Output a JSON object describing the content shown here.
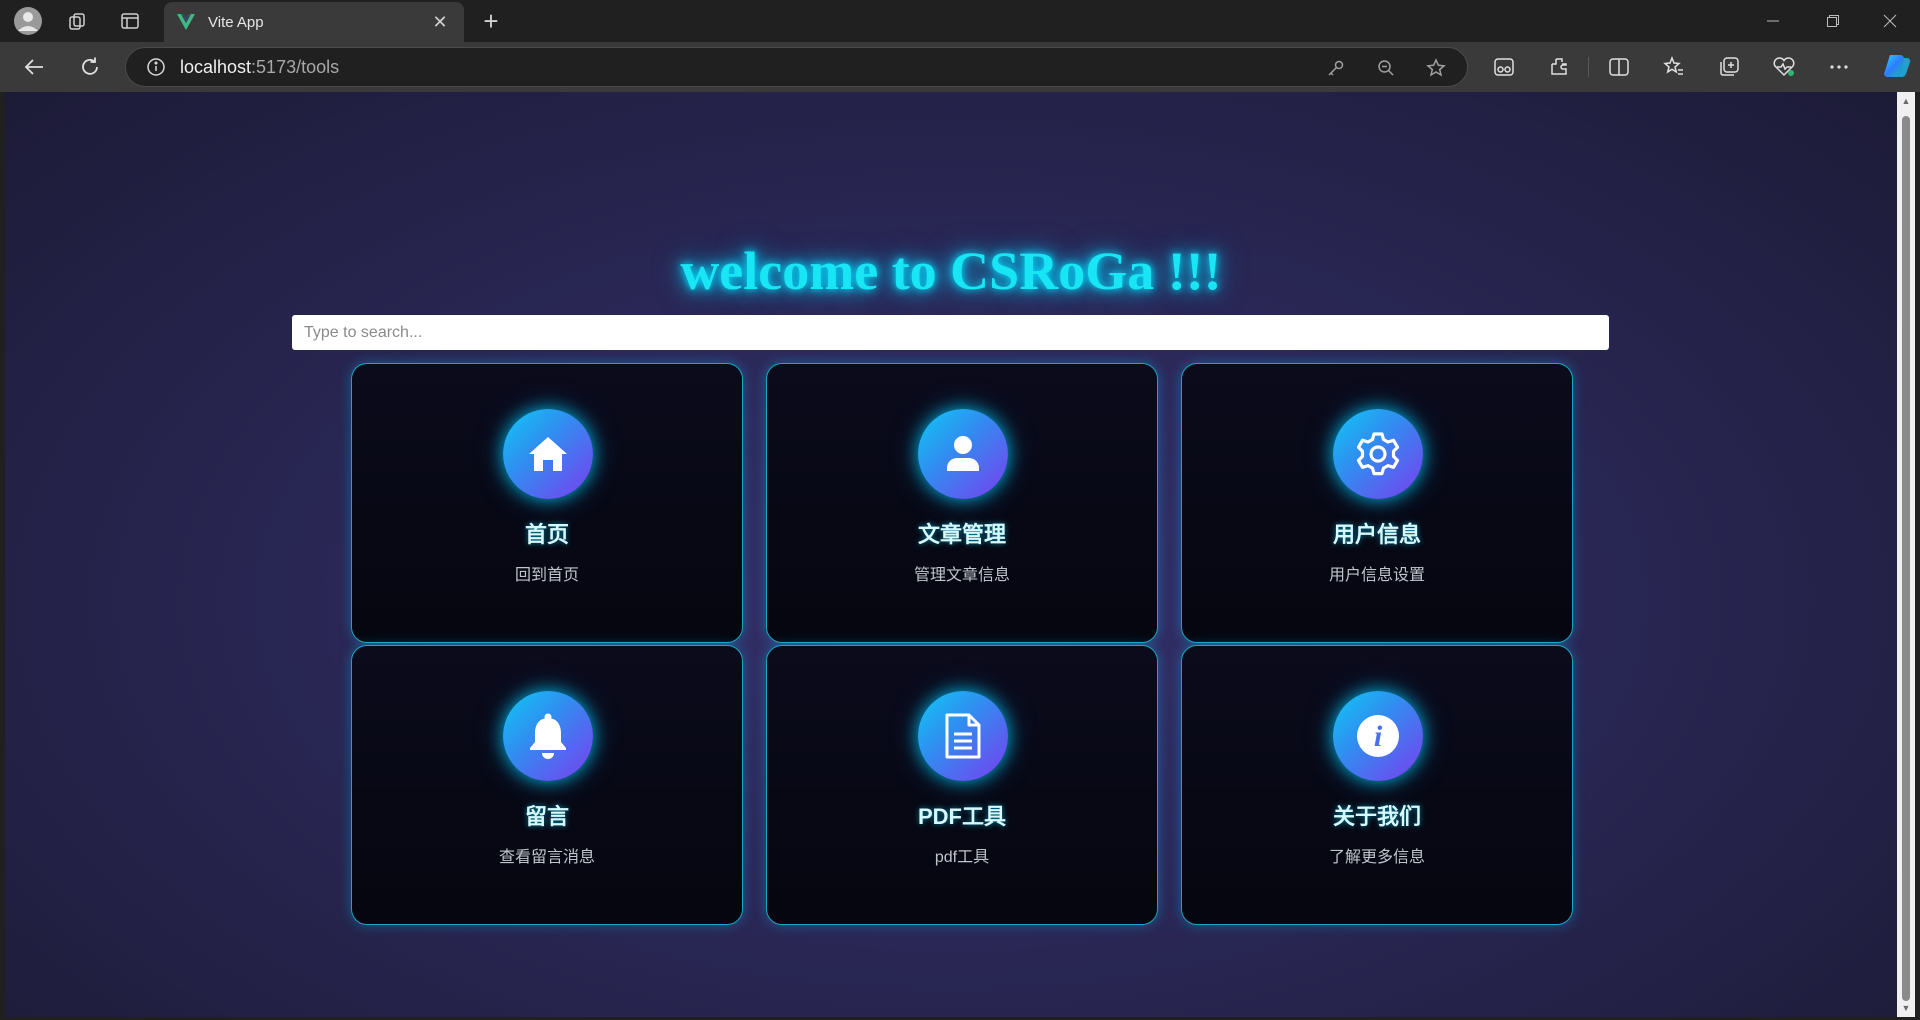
{
  "browser": {
    "tab_title": "Vite App",
    "url_host": "localhost",
    "url_path": ":5173/tools"
  },
  "page": {
    "title": "welcome to CSRoGa !!!",
    "search_placeholder": "Type to search..."
  },
  "cards": [
    {
      "title": "首页",
      "desc": "回到首页",
      "icon": "home-icon"
    },
    {
      "title": "文章管理",
      "desc": "管理文章信息",
      "icon": "user-icon"
    },
    {
      "title": "用户信息",
      "desc": "用户信息设置",
      "icon": "gear-icon"
    },
    {
      "title": "留言",
      "desc": "查看留言消息",
      "icon": "bell-icon"
    },
    {
      "title": "PDF工具",
      "desc": "pdf工具",
      "icon": "document-icon"
    },
    {
      "title": "关于我们",
      "desc": "了解更多信息",
      "icon": "info-icon"
    }
  ],
  "colors": {
    "accent_cyan": "#19e6f4",
    "card_border": "#1aa6c0",
    "icon_gradient_start": "#10c8f5",
    "icon_gradient_end": "#7a3df0"
  }
}
